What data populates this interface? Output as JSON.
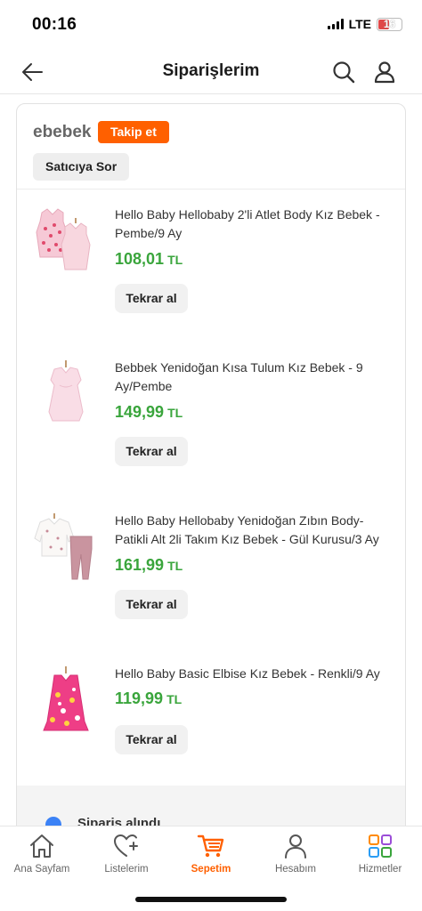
{
  "status_bar": {
    "time": "00:16",
    "network": "LTE",
    "battery": "16"
  },
  "header": {
    "title": "Siparişlerim"
  },
  "seller": {
    "name": "ebebek",
    "follow_label": "Takip et",
    "ask_label": "Satıcıya Sor"
  },
  "products": [
    {
      "title": "Hello Baby Hellobaby 2'li Atlet Body Kız Bebek - Pembe/9 Ay",
      "price": "108,01",
      "currency": "TL",
      "rebuy_label": "Tekrar al",
      "image": "pink-bodysuits-image"
    },
    {
      "title": "Bebbek Yenidoğan Kısa Tulum Kız Bebek - 9 Ay/Pembe",
      "price": "149,99",
      "currency": "TL",
      "rebuy_label": "Tekrar al",
      "image": "pink-romper-image"
    },
    {
      "title": "Hello Baby Hellobaby Yenidoğan Zıbın Body-Patikli Alt 2li Takım Kız Bebek - Gül Kurusu/3 Ay",
      "price": "161,99",
      "currency": "TL",
      "rebuy_label": "Tekrar al",
      "image": "baby-set-image"
    },
    {
      "title": "Hello Baby Basic Elbise Kız Bebek - Renkli/9 Ay",
      "price": "119,99",
      "currency": "TL",
      "rebuy_label": "Tekrar al",
      "image": "floral-dress-image"
    }
  ],
  "footer_partial": {
    "text": "Sipariş alındı"
  },
  "nav": [
    {
      "label": "Ana Sayfam",
      "icon": "home-icon",
      "active": false
    },
    {
      "label": "Listelerim",
      "icon": "heart-list-icon",
      "active": false
    },
    {
      "label": "Sepetim",
      "icon": "cart-icon",
      "active": true
    },
    {
      "label": "Hesabım",
      "icon": "user-icon",
      "active": false
    },
    {
      "label": "Hizmetler",
      "icon": "services-icon",
      "active": false
    }
  ],
  "colors": {
    "accent": "#ff6000",
    "price": "#3aa53c"
  }
}
